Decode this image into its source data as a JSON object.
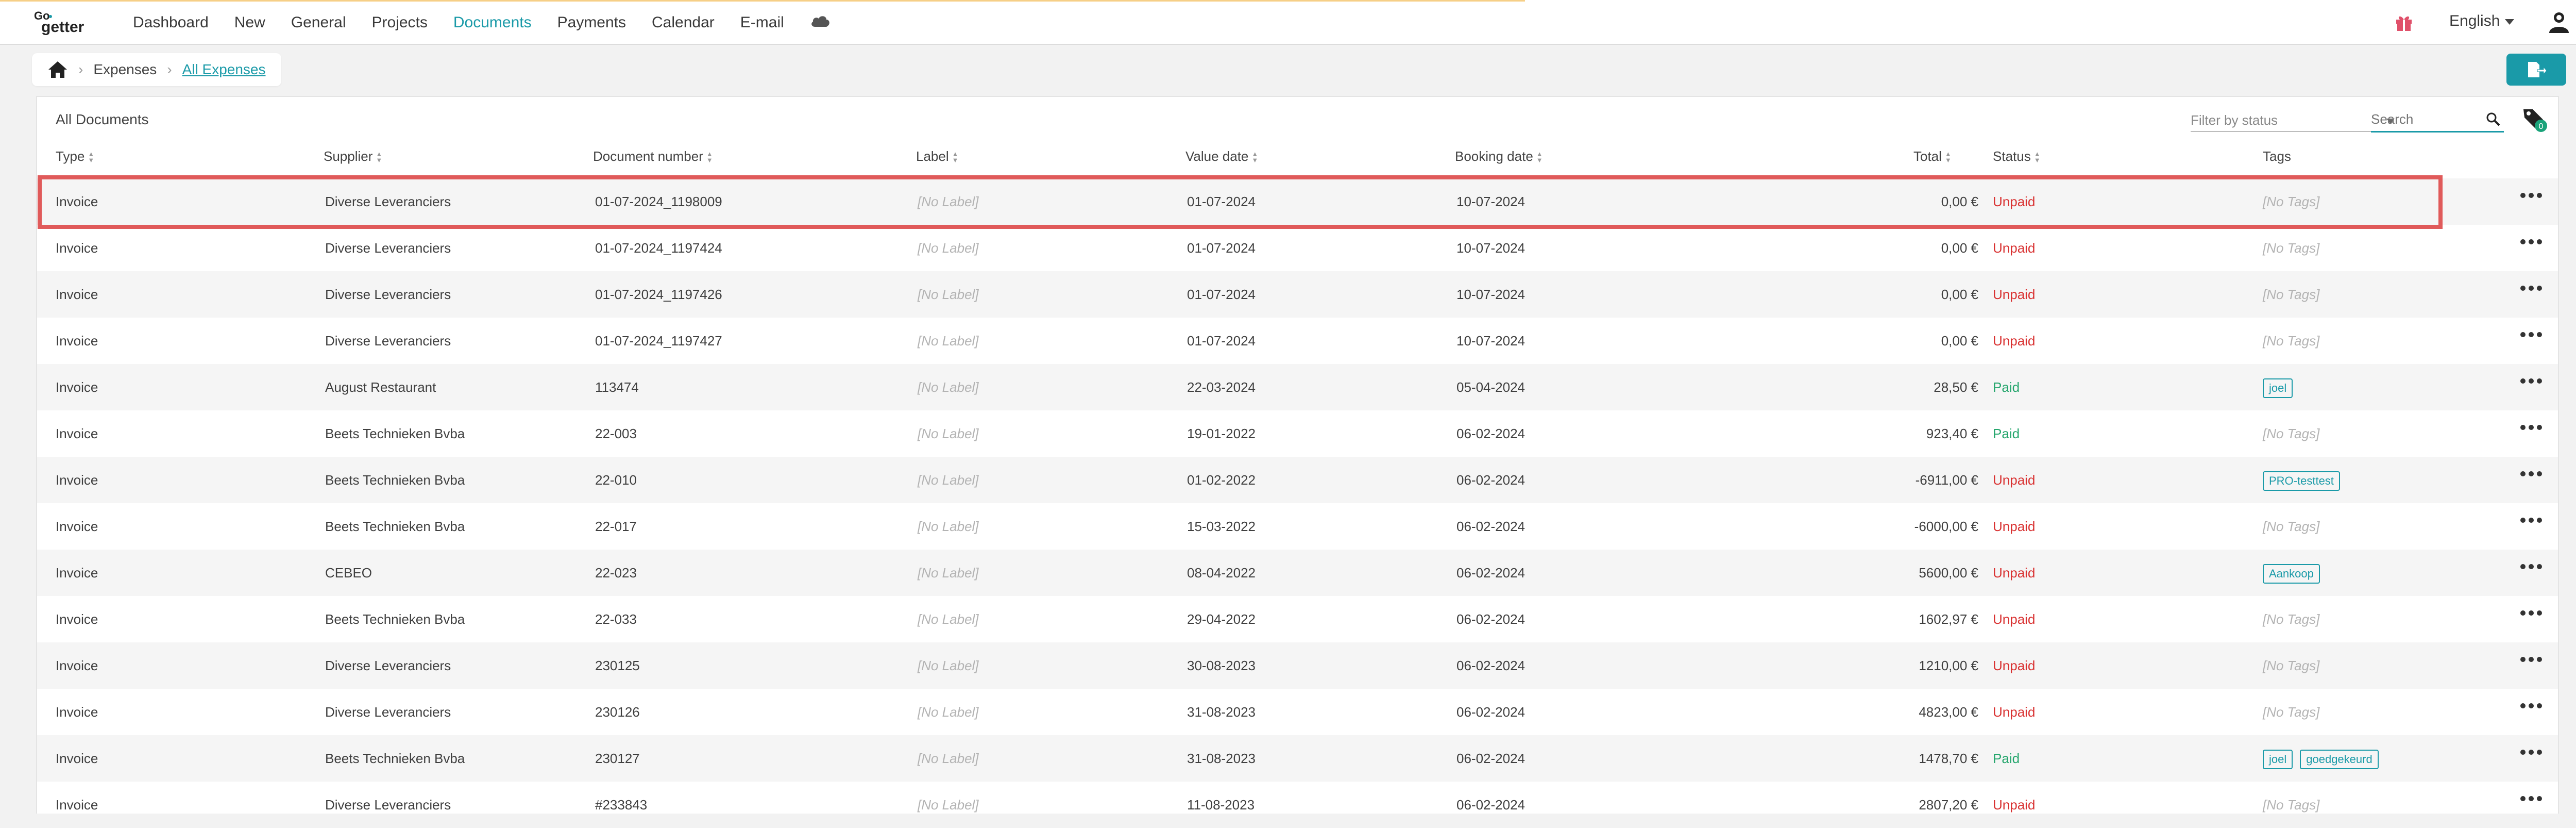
{
  "app": {
    "logo_text": "GoGetter",
    "accent_color": "#1a9aa8",
    "unpaid_color": "#d93232",
    "paid_color": "#24a56c"
  },
  "nav": {
    "items": [
      {
        "label": "Dashboard",
        "active": false
      },
      {
        "label": "New",
        "active": false
      },
      {
        "label": "General",
        "active": false
      },
      {
        "label": "Projects",
        "active": false
      },
      {
        "label": "Documents",
        "active": true
      },
      {
        "label": "Payments",
        "active": false
      },
      {
        "label": "Calendar",
        "active": false
      },
      {
        "label": "E-mail",
        "active": false
      }
    ],
    "cloud_icon": "cloud-icon",
    "gift_icon": "gift-icon",
    "language": "English",
    "user_icon": "user-icon"
  },
  "breadcrumb": {
    "home_icon": "home-icon",
    "items": [
      "Expenses",
      "All Expenses"
    ]
  },
  "toolbar": {
    "export_icon": "export-document-icon"
  },
  "card": {
    "title": "All Documents",
    "filter_placeholder": "Filter by status",
    "search_placeholder": "Search",
    "tag_filter_count": "0"
  },
  "columns": {
    "type": "Type",
    "supplier": "Supplier",
    "document_number": "Document number",
    "label": "Label",
    "value_date": "Value date",
    "booking_date": "Booking date",
    "total": "Total",
    "status": "Status",
    "tags": "Tags"
  },
  "rows": [
    {
      "type": "Invoice",
      "supplier": "Diverse Leveranciers",
      "document_number": "01-07-2024_1198009",
      "label": "[No Label]",
      "value_date": "01-07-2024",
      "booking_date": "10-07-2024",
      "total": "0,00 €",
      "status": "Unpaid",
      "tags": [],
      "no_tags": "[No Tags]"
    },
    {
      "type": "Invoice",
      "supplier": "Diverse Leveranciers",
      "document_number": "01-07-2024_1197424",
      "label": "[No Label]",
      "value_date": "01-07-2024",
      "booking_date": "10-07-2024",
      "total": "0,00 €",
      "status": "Unpaid",
      "tags": [],
      "no_tags": "[No Tags]"
    },
    {
      "type": "Invoice",
      "supplier": "Diverse Leveranciers",
      "document_number": "01-07-2024_1197426",
      "label": "[No Label]",
      "value_date": "01-07-2024",
      "booking_date": "10-07-2024",
      "total": "0,00 €",
      "status": "Unpaid",
      "tags": [],
      "no_tags": "[No Tags]"
    },
    {
      "type": "Invoice",
      "supplier": "Diverse Leveranciers",
      "document_number": "01-07-2024_1197427",
      "label": "[No Label]",
      "value_date": "01-07-2024",
      "booking_date": "10-07-2024",
      "total": "0,00 €",
      "status": "Unpaid",
      "tags": [],
      "no_tags": "[No Tags]"
    },
    {
      "type": "Invoice",
      "supplier": "August Restaurant",
      "document_number": "113474",
      "label": "[No Label]",
      "value_date": "22-03-2024",
      "booking_date": "05-04-2024",
      "total": "28,50 €",
      "status": "Paid",
      "tags": [
        "joel"
      ],
      "no_tags": ""
    },
    {
      "type": "Invoice",
      "supplier": "Beets Technieken Bvba",
      "document_number": "22-003",
      "label": "[No Label]",
      "value_date": "19-01-2022",
      "booking_date": "06-02-2024",
      "total": "923,40 €",
      "status": "Paid",
      "tags": [],
      "no_tags": "[No Tags]"
    },
    {
      "type": "Invoice",
      "supplier": "Beets Technieken Bvba",
      "document_number": "22-010",
      "label": "[No Label]",
      "value_date": "01-02-2022",
      "booking_date": "06-02-2024",
      "total": "-6911,00 €",
      "status": "Unpaid",
      "tags": [
        "PRO-testtest"
      ],
      "no_tags": ""
    },
    {
      "type": "Invoice",
      "supplier": "Beets Technieken Bvba",
      "document_number": "22-017",
      "label": "[No Label]",
      "value_date": "15-03-2022",
      "booking_date": "06-02-2024",
      "total": "-6000,00 €",
      "status": "Unpaid",
      "tags": [],
      "no_tags": "[No Tags]"
    },
    {
      "type": "Invoice",
      "supplier": "CEBEO",
      "document_number": "22-023",
      "label": "[No Label]",
      "value_date": "08-04-2022",
      "booking_date": "06-02-2024",
      "total": "5600,00 €",
      "status": "Unpaid",
      "tags": [
        "Aankoop"
      ],
      "no_tags": ""
    },
    {
      "type": "Invoice",
      "supplier": "Beets Technieken Bvba",
      "document_number": "22-033",
      "label": "[No Label]",
      "value_date": "29-04-2022",
      "booking_date": "06-02-2024",
      "total": "1602,97 €",
      "status": "Unpaid",
      "tags": [],
      "no_tags": "[No Tags]"
    },
    {
      "type": "Invoice",
      "supplier": "Diverse Leveranciers",
      "document_number": "230125",
      "label": "[No Label]",
      "value_date": "30-08-2023",
      "booking_date": "06-02-2024",
      "total": "1210,00 €",
      "status": "Unpaid",
      "tags": [],
      "no_tags": "[No Tags]"
    },
    {
      "type": "Invoice",
      "supplier": "Diverse Leveranciers",
      "document_number": "230126",
      "label": "[No Label]",
      "value_date": "31-08-2023",
      "booking_date": "06-02-2024",
      "total": "4823,00 €",
      "status": "Unpaid",
      "tags": [],
      "no_tags": "[No Tags]"
    },
    {
      "type": "Invoice",
      "supplier": "Beets Technieken Bvba",
      "document_number": "230127",
      "label": "[No Label]",
      "value_date": "31-08-2023",
      "booking_date": "06-02-2024",
      "total": "1478,70 €",
      "status": "Paid",
      "tags": [
        "joel",
        "goedgekeurd"
      ],
      "no_tags": ""
    },
    {
      "type": "Invoice",
      "supplier": "Diverse Leveranciers",
      "document_number": "#233843",
      "label": "[No Label]",
      "value_date": "11-08-2023",
      "booking_date": "06-02-2024",
      "total": "2807,20 €",
      "status": "Unpaid",
      "tags": [],
      "no_tags": "[No Tags]"
    }
  ],
  "row_actions_icon": "more-horizontal-icon"
}
